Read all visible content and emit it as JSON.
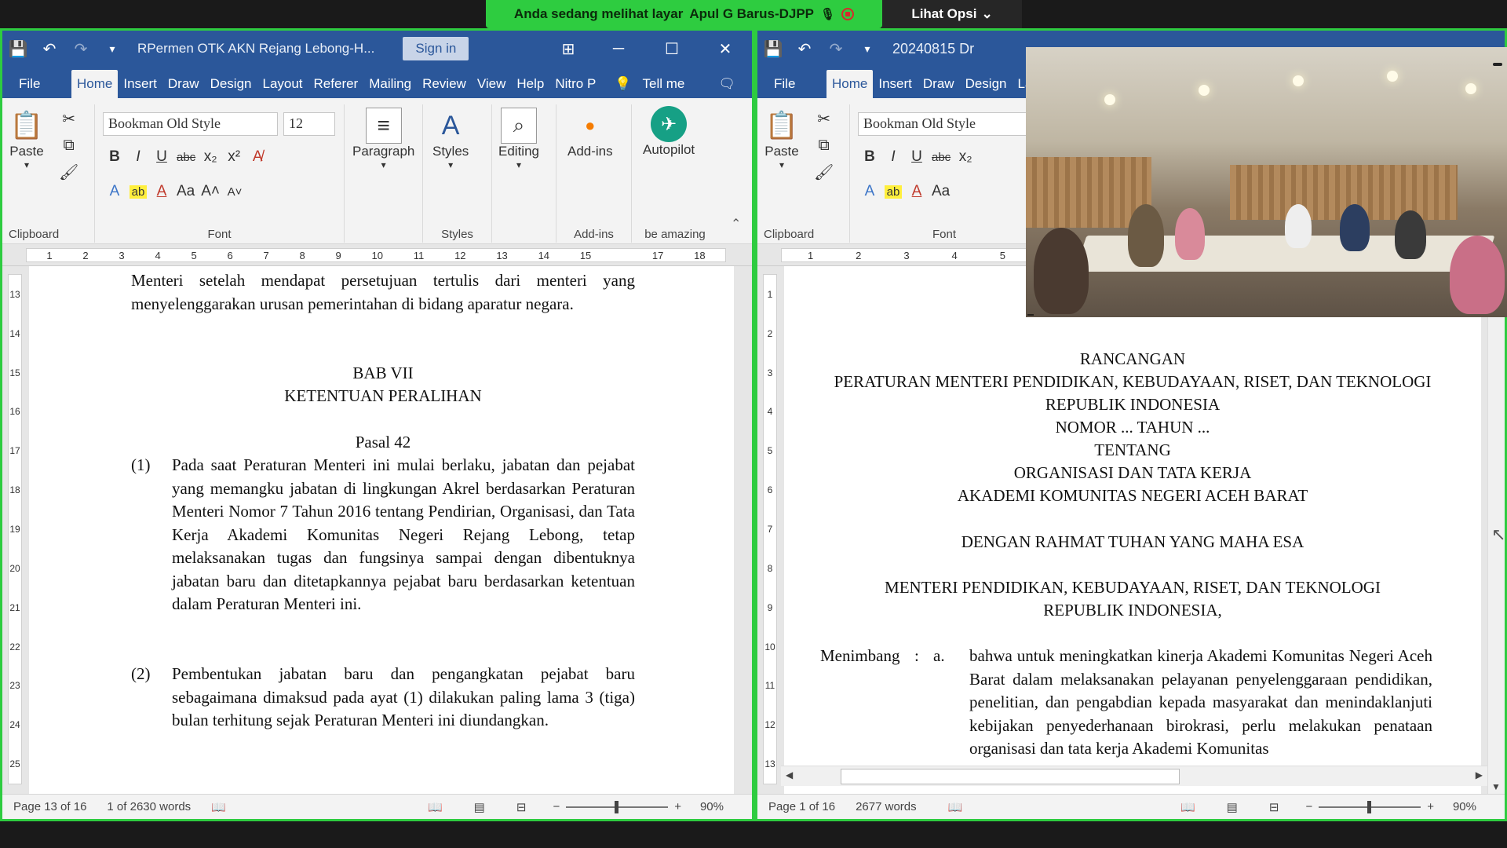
{
  "banner": {
    "text": "Anda sedang melihat layar",
    "presenter": "Apul G Barus-DJPP",
    "options": "Lihat Opsi"
  },
  "left": {
    "title": "RPermen OTK AKN Rejang Lebong-H...",
    "signin": "Sign in",
    "tabs": [
      "File",
      "Home",
      "Insert",
      "Draw",
      "Design",
      "Layout",
      "Referer",
      "Mailing",
      "Review",
      "View",
      "Help",
      "Nitro P"
    ],
    "tellme": "Tell me",
    "ribbon": {
      "paste": "Paste",
      "clipboard": "Clipboard",
      "font_name": "Bookman Old Style",
      "font_size": "12",
      "font_group": "Font",
      "paragraph": "Paragraph",
      "styles": "Styles",
      "styles_group": "Styles",
      "editing": "Editing",
      "addins": "Add-ins",
      "addins_group": "Add-ins",
      "autopilot": "Autopilot",
      "be_amazing": "be amazing"
    },
    "ruler": [
      "1",
      "2",
      "3",
      "4",
      "5",
      "6",
      "7",
      "8",
      "9",
      "10",
      "11",
      "12",
      "13",
      "14",
      "15",
      "",
      "17",
      "18"
    ],
    "vruler": [
      "13",
      "14",
      "15",
      "16",
      "17",
      "18",
      "19",
      "20",
      "21",
      "22",
      "23",
      "24",
      "25"
    ],
    "doc": {
      "intro": "Menteri setelah mendapat persetujuan tertulis dari menteri yang menyelenggarakan urusan pemerintahan di bidang aparatur negara.",
      "bab": "BAB VII",
      "bab_title": "KETENTUAN PERALIHAN",
      "pasal": "Pasal 42",
      "p1_num": "(1)",
      "p1": "Pada saat Peraturan Menteri ini mulai berlaku, jabatan dan pejabat yang memangku jabatan di lingkungan Akrel berdasarkan Peraturan Menteri Nomor 7 Tahun 2016 tentang Pendirian, Organisasi, dan Tata Kerja Akademi Komunitas Negeri Rejang Lebong, tetap melaksanakan tugas dan fungsinya sampai dengan dibentuknya jabatan baru dan ditetapkannya pejabat baru berdasarkan ketentuan dalam Peraturan Menteri ini.",
      "p2_num": "(2)",
      "p2": "Pembentukan jabatan baru dan pengangkatan pejabat baru sebagaimana dimaksud pada ayat (1) dilakukan paling lama 3 (tiga) bulan terhitung sejak Peraturan Menteri ini diundangkan."
    },
    "status": {
      "page": "Page 13 of 16",
      "words": "1 of 2630 words",
      "zoom": "90%"
    }
  },
  "right": {
    "title": "20240815 Dr",
    "tabs": [
      "File",
      "Home",
      "Insert",
      "Draw",
      "Design",
      "La"
    ],
    "ribbon": {
      "paste": "Paste",
      "clipboard": "Clipboard",
      "font_name": "Bookman Old Style",
      "font_group": "Font"
    },
    "ruler": [
      "1",
      "2",
      "3",
      "4",
      "5"
    ],
    "vruler": [
      "1",
      "2",
      "3",
      "4",
      "5",
      "6",
      "7",
      "8",
      "9",
      "10",
      "11",
      "12",
      "13"
    ],
    "doc": {
      "l1": "RANCANGAN",
      "l2": "PERATURAN MENTERI PENDIDIKAN, KEBUDAYAAN, RISET, DAN TEKNOLOGI",
      "l3": "REPUBLIK INDONESIA",
      "l4": "NOMOR ... TAHUN ...",
      "l5": "TENTANG",
      "l6": "ORGANISASI DAN TATA KERJA",
      "l7": "AKADEMI KOMUNITAS NEGERI ACEH BARAT",
      "l8": "DENGAN RAHMAT TUHAN YANG MAHA ESA",
      "l9": "MENTERI PENDIDIKAN, KEBUDAYAAN, RISET, DAN TEKNOLOGI",
      "l10": "REPUBLIK INDONESIA,",
      "menimbang": "Menimbang",
      "colon": ":",
      "a": "a.",
      "a_text": "bahwa untuk meningkatkan kinerja Akademi Komunitas Negeri Aceh Barat dalam melaksanakan pelayanan penyelenggaraan pendidikan, penelitian, dan pengabdian kepada masyarakat dan menindaklanjuti kebijakan penyederhanaan birokrasi, perlu melakukan penataan organisasi dan tata kerja Akademi Komunitas"
    },
    "status": {
      "page": "Page 1 of 16",
      "words": "2677 words",
      "zoom": "90%"
    }
  },
  "colors": {
    "accent_green": "#2ecc40",
    "word_blue": "#2b579a"
  }
}
